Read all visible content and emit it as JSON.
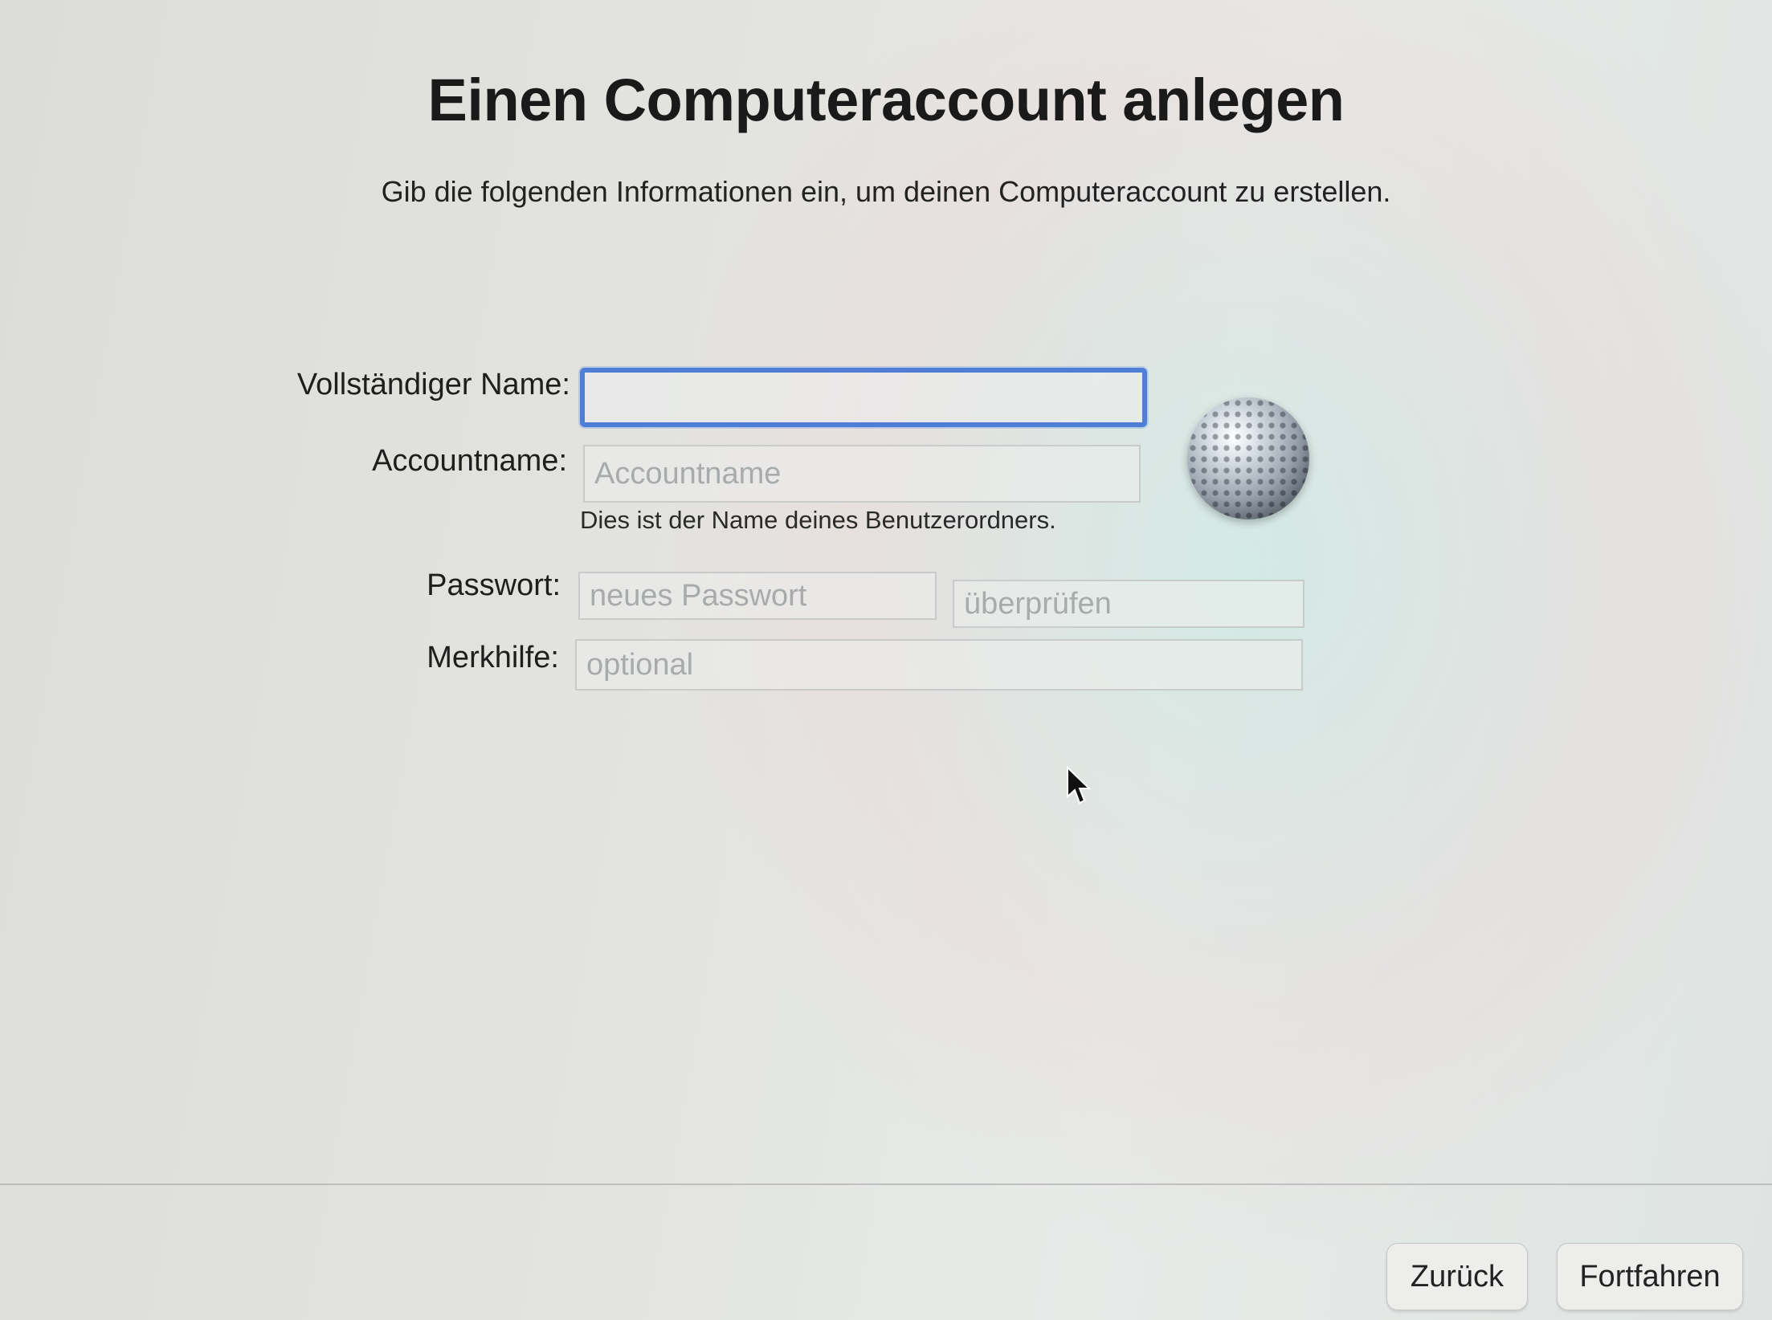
{
  "header": {
    "title": "Einen Computeraccount anlegen",
    "subtitle": "Gib die folgenden Informationen ein, um deinen Computeraccount zu erstellen."
  },
  "form": {
    "full_name": {
      "label": "Vollständiger Name:",
      "value": "",
      "placeholder": ""
    },
    "account_name": {
      "label": "Accountname:",
      "value": "",
      "placeholder": "Accountname",
      "hint": "Dies ist der Name deines Benutzerordners."
    },
    "password": {
      "label": "Passwort:",
      "placeholder": "neues Passwort",
      "verify_placeholder": "überprüfen"
    },
    "hint_field": {
      "label": "Merkhilfe:",
      "placeholder": "optional"
    }
  },
  "avatar": {
    "icon": "golf-ball-avatar-icon"
  },
  "footer": {
    "back_label": "Zurück",
    "continue_label": "Fortfahren"
  }
}
